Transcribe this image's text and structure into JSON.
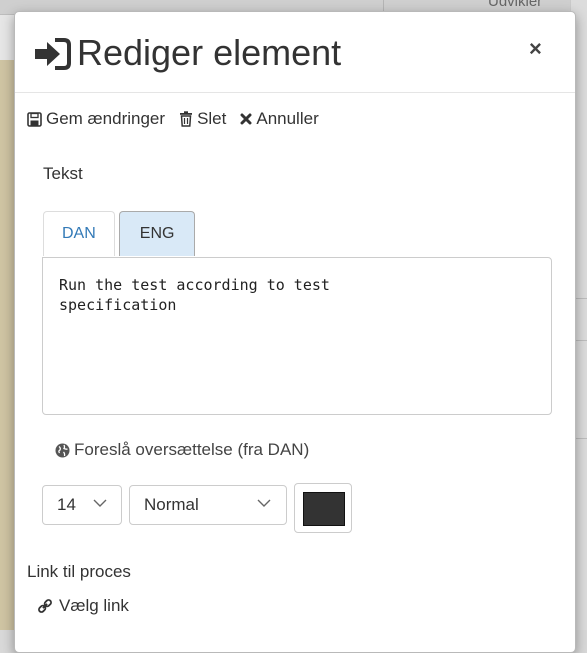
{
  "background": {
    "topbar_text": "Udvikler"
  },
  "modal": {
    "title": "Rediger element",
    "close_label": "×",
    "toolbar": {
      "save_label": "Gem ændringer",
      "delete_label": "Slet",
      "cancel_label": "Annuller"
    },
    "text_field": {
      "label": "Tekst",
      "tabs": [
        {
          "label": "DAN",
          "active": false
        },
        {
          "label": "ENG",
          "active": true
        }
      ],
      "value": "Run the test according to test\nspecification"
    },
    "suggest_translation_label": "Foreslå oversættelse (fra DAN)",
    "font_size": {
      "selected": "14"
    },
    "font_style": {
      "selected": "Normal"
    },
    "color": {
      "value": "#333333"
    },
    "link": {
      "label": "Link til proces",
      "choose_label": "Vælg link"
    }
  },
  "icons": {
    "title": "sign-in-icon",
    "save": "floppy-disk-icon",
    "delete": "trash-icon",
    "cancel": "times-icon",
    "suggest": "globe-icon",
    "link": "link-icon"
  }
}
